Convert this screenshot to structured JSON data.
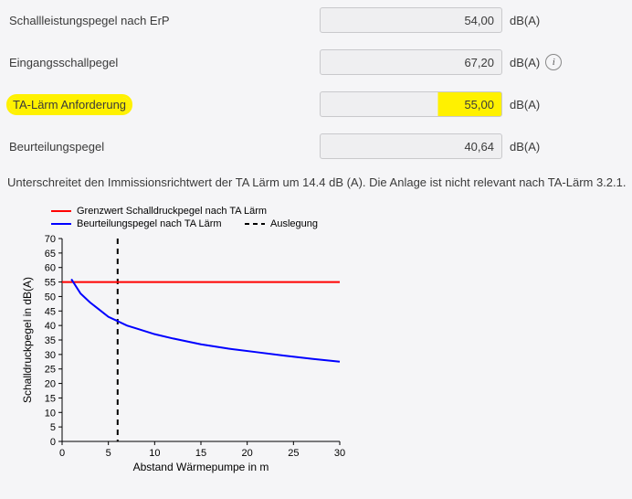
{
  "fields": {
    "schallleistung": {
      "label": "Schallleistungspegel nach ErP",
      "value": "54,00",
      "unit": "dB(A)"
    },
    "eingang": {
      "label": "Eingangsschallpegel",
      "value": "67,20",
      "unit": "dB(A)"
    },
    "talarm": {
      "label": "TA-Lärm Anforderung",
      "value": "55,00",
      "unit": "dB(A)"
    },
    "beurteilung": {
      "label": "Beurteilungspegel",
      "value": "40,64",
      "unit": "dB(A)"
    }
  },
  "info_glyph": "i",
  "result_text": "Unterschreitet den Immissionsrichtwert der TA Lärm um 14.4 dB (A). Die Anlage ist nicht relevant nach TA-Lärm 3.2.1.",
  "chart_data": {
    "type": "line",
    "xlabel": "Abstand Wärmepumpe in m",
    "ylabel": "Schalldruckpegel in dB(A)",
    "xlim": [
      0,
      30
    ],
    "ylim": [
      0,
      70
    ],
    "xticks": [
      0,
      5,
      10,
      15,
      20,
      25,
      30
    ],
    "yticks": [
      0,
      5,
      10,
      15,
      20,
      25,
      30,
      35,
      40,
      45,
      50,
      55,
      60,
      65,
      70
    ],
    "legend": {
      "grenzwert": "Grenzwert Schalldruckpegel nach TA Lärm",
      "beurteilung": "Beurteilungspegel nach TA Lärm",
      "auslegung": "Auslegung"
    },
    "auslegung_x": 6,
    "series": [
      {
        "name": "Grenzwert Schalldruckpegel nach TA Lärm",
        "color": "#ff0000",
        "x": [
          0,
          30
        ],
        "y": [
          55,
          55
        ]
      },
      {
        "name": "Beurteilungspegel nach TA Lärm",
        "color": "#0000ff",
        "x": [
          1,
          2,
          3,
          4,
          5,
          6,
          7,
          8,
          10,
          12,
          15,
          18,
          21,
          24,
          27,
          30
        ],
        "y": [
          56,
          51,
          48,
          45.5,
          43,
          41.5,
          40,
          39,
          37,
          35.5,
          33.5,
          32,
          30.8,
          29.6,
          28.5,
          27.5
        ]
      }
    ]
  }
}
